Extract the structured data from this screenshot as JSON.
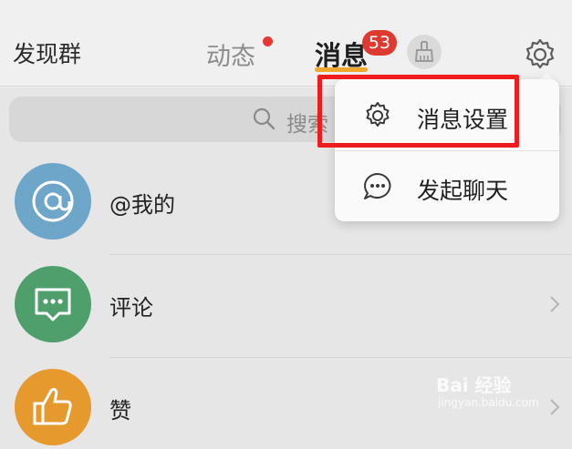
{
  "header": {
    "left_title": "发现群",
    "tabs": [
      {
        "label": "动态",
        "has_dot": true
      },
      {
        "label": "消息",
        "active": true,
        "badge": "53"
      }
    ],
    "icons": [
      "clean-brush-icon",
      "settings-gear-icon"
    ]
  },
  "search": {
    "placeholder": "搜索"
  },
  "list": [
    {
      "label": "@我的",
      "icon": "at-icon",
      "color": "#6ea6c9"
    },
    {
      "label": "评论",
      "icon": "comment-icon",
      "color": "#4f9f6c"
    },
    {
      "label": "赞",
      "icon": "thumbs-up-icon",
      "color": "#e69a2e"
    }
  ],
  "menu": {
    "items": [
      {
        "label": "消息设置",
        "icon": "settings-icon",
        "highlighted": true
      },
      {
        "label": "发起聊天",
        "icon": "chat-bubble-icon"
      }
    ]
  },
  "watermark": {
    "main": "Bai 经验",
    "sub": "jingyan.baidu.com"
  },
  "colors": {
    "accent_underline": "#f1a62e",
    "badge": "#dd3b30",
    "highlight_box": "#ee1c1c"
  }
}
